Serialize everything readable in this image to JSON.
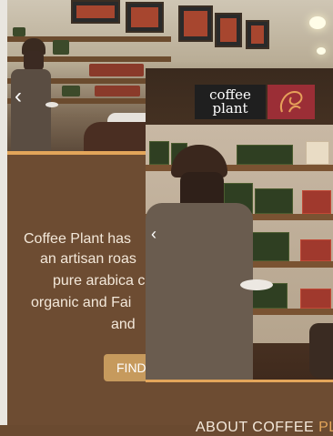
{
  "back_screen": {
    "heading": "ABOUT C",
    "body_lines": [
      "Coffee Plant has",
      "an artisan roas",
      "pure arabica c",
      "organic and Fai",
      "and"
    ],
    "button_label": "FIND",
    "prev_arrow": "‹"
  },
  "front_screen": {
    "logo_text_line1": "coffee",
    "logo_text_line2": "plant",
    "prev_arrow": "‹",
    "heading_main": "ABOUT COFFEE ",
    "heading_accent": "PL"
  },
  "colors": {
    "panel_brown": "#6d4c32",
    "accent_gold": "#e3a55a",
    "button_tan": "#c69a5d",
    "logo_red": "#9b2e36"
  }
}
